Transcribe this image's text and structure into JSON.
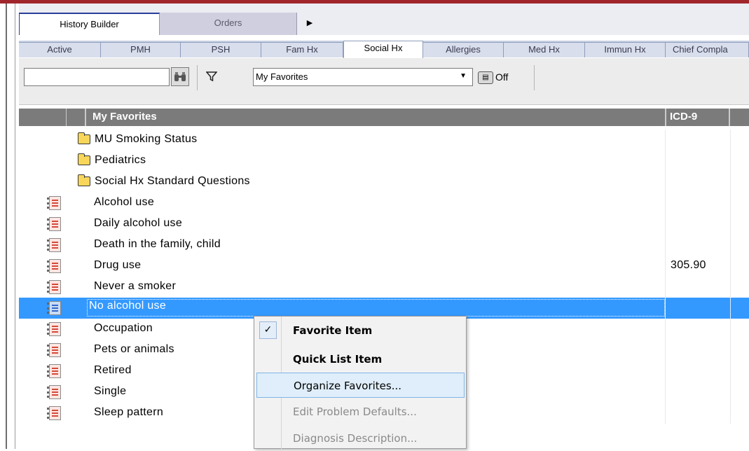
{
  "tabs": {
    "history_builder": "History Builder",
    "orders": "Orders",
    "more_arrow": "▶"
  },
  "subtabs": [
    "Active",
    "PMH",
    "PSH",
    "Fam Hx",
    "Social Hx",
    "Allergies",
    "Med Hx",
    "Immun Hx",
    "Chief Compla"
  ],
  "toolbar": {
    "search_value": "",
    "favorites_selected": "My Favorites",
    "off_label": "Off"
  },
  "grid": {
    "header_title": "My Favorites",
    "header_icd": "ICD-9",
    "folders": [
      "MU Smoking Status",
      "Pediatrics",
      "Social Hx Standard Questions"
    ],
    "items": [
      {
        "label": "Alcohol use",
        "icd": ""
      },
      {
        "label": "Daily alcohol use",
        "icd": ""
      },
      {
        "label": "Death in the family, child",
        "icd": ""
      },
      {
        "label": "Drug use",
        "icd": "305.90"
      },
      {
        "label": "Never a smoker",
        "icd": ""
      },
      {
        "label": "No alcohol use",
        "icd": "",
        "selected": true
      },
      {
        "label": "Occupation",
        "icd": ""
      },
      {
        "label": "Pets or animals",
        "icd": ""
      },
      {
        "label": "Retired",
        "icd": ""
      },
      {
        "label": "Single",
        "icd": ""
      },
      {
        "label": "Sleep pattern",
        "icd": ""
      }
    ]
  },
  "context_menu": {
    "items": [
      {
        "label": "Favorite Item",
        "checked": true,
        "bold": true
      },
      {
        "label": "Quick List Item",
        "bold": true
      },
      {
        "label": "Organize Favorites...",
        "hover": true
      },
      {
        "label": "Edit Problem Defaults...",
        "disabled": true
      },
      {
        "label": "Diagnosis Description...",
        "disabled": true
      }
    ],
    "check_glyph": "✓"
  },
  "colors": {
    "top_border": "#a1262c",
    "selection": "#3399ff",
    "header_bg": "#7b7b7b"
  }
}
